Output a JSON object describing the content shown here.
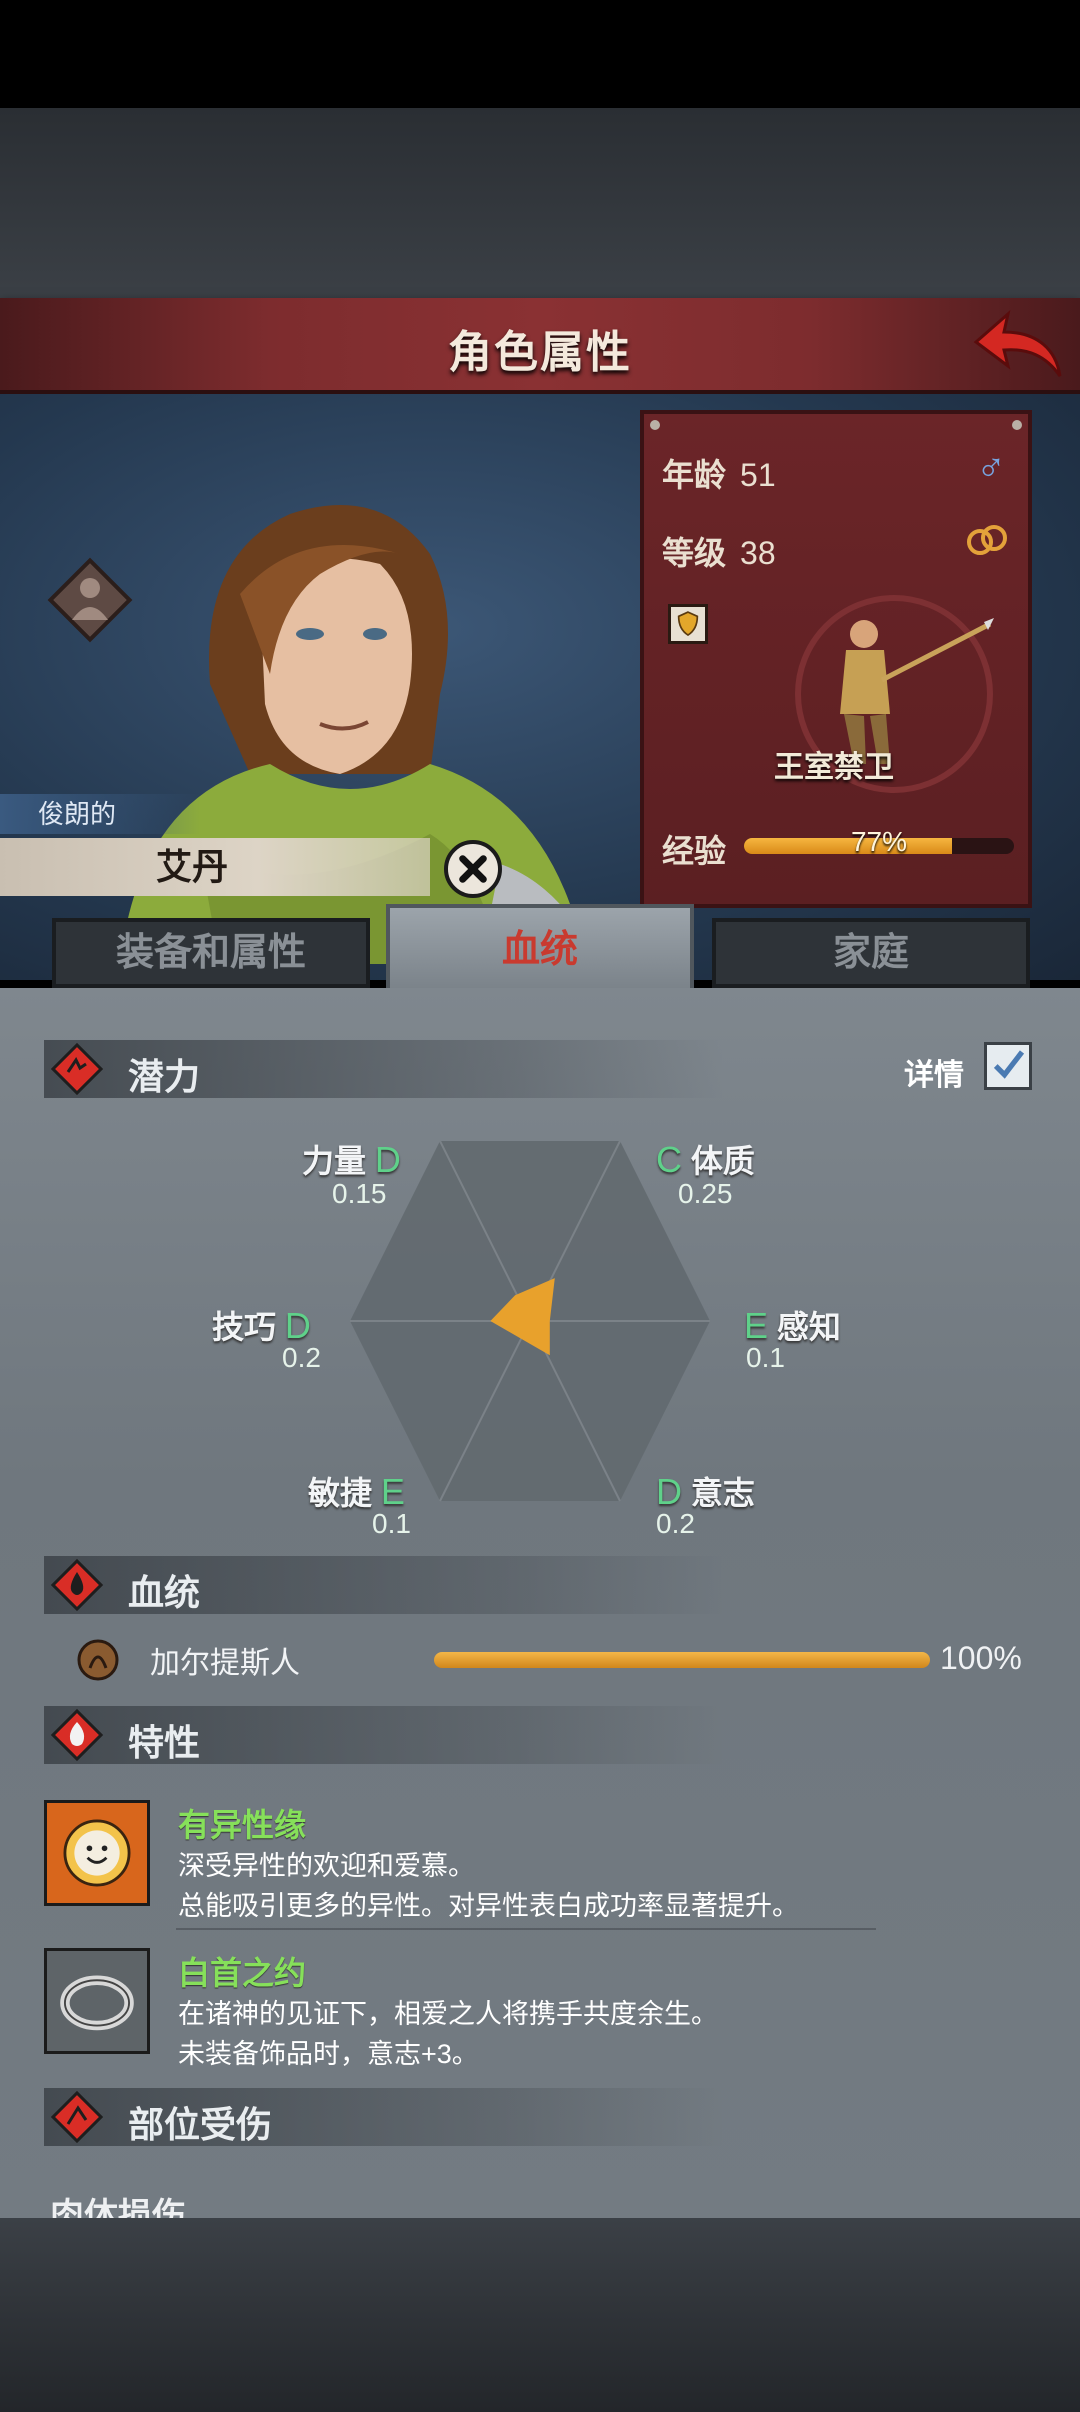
{
  "header": {
    "title": "角色属性"
  },
  "character": {
    "adjective": "俊朗的",
    "name": "艾丹",
    "stats_card": {
      "age_label": "年龄",
      "age": "51",
      "level_label": "等级",
      "level": "38",
      "unit_name": "王室禁卫",
      "exp_label": "经验",
      "exp_text": "77%",
      "exp_fraction": 0.77
    }
  },
  "tabs": [
    {
      "label": "装备和属性",
      "active": false
    },
    {
      "label": "血统",
      "active": true
    },
    {
      "label": "家庭",
      "active": false
    }
  ],
  "potential": {
    "title": "潜力",
    "detail_label": "详情",
    "detail_checked": true,
    "stats": {
      "strength": {
        "label": "力量",
        "grade": "D",
        "value": "0.15"
      },
      "constitution": {
        "label": "体质",
        "grade": "C",
        "value": "0.25"
      },
      "perception": {
        "label": "感知",
        "grade": "E",
        "value": "0.1"
      },
      "will": {
        "label": "意志",
        "grade": "D",
        "value": "0.2"
      },
      "agility": {
        "label": "敏捷",
        "grade": "E",
        "value": "0.1"
      },
      "skill": {
        "label": "技巧",
        "grade": "D",
        "value": "0.2"
      }
    }
  },
  "lineage": {
    "title": "血统",
    "items": [
      {
        "name": "加尔提斯人",
        "percent_text": "100%",
        "fraction": 1.0
      }
    ]
  },
  "traits": {
    "title": "特性",
    "items": [
      {
        "name": "有异性缘",
        "line1": "深受异性的欢迎和爱慕。",
        "line2": "总能吸引更多的异性。对异性表白成功率显著提升。",
        "icon": "smiley-sun-icon"
      },
      {
        "name": "白首之约",
        "line1": "在诸神的见证下，相爱之人将携手共度余生。",
        "line2": "未装备饰品时，意志+3。",
        "icon": "ring-icon"
      }
    ]
  },
  "injuries": {
    "title": "部位受伤",
    "sub": "肉体损伤"
  },
  "colors": {
    "accent_red": "#c93a2f",
    "grade_green": "#5fd18a",
    "bar_orange": "#e49b2a"
  }
}
